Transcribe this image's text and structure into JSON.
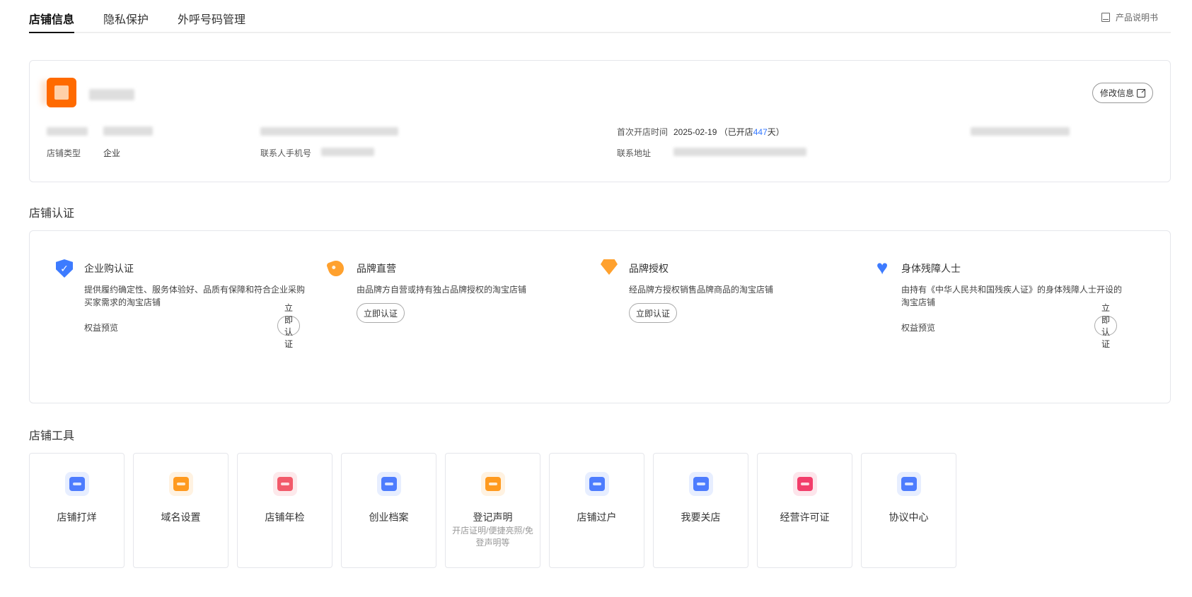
{
  "tabs": [
    {
      "label": "店铺信息",
      "active": true
    },
    {
      "label": "隐私保护",
      "active": false
    },
    {
      "label": "外呼号码管理",
      "active": false
    }
  ],
  "manual": {
    "label": "产品说明书",
    "icon": "book-icon"
  },
  "shop_info": {
    "edit_button": "修改信息",
    "shop_type_label": "店铺类型",
    "shop_type_value": "企业",
    "contact_phone_label": "联系人手机号",
    "first_open_label": "首次开店时间",
    "first_open_date": "2025-02-19",
    "open_prefix": "（已开店",
    "open_days": "447",
    "open_suffix": "天）",
    "address_label": "联系地址"
  },
  "certification": {
    "title": "店铺认证",
    "items": [
      {
        "title": "企业购认证",
        "icon": "shield-check-icon",
        "desc": "提供履约确定性、服务体验好、品质有保障和符合企业采购买家需求的淘宝店铺",
        "benefit": "权益预览",
        "button": "立即认证"
      },
      {
        "title": "品牌直营",
        "icon": "tag-icon",
        "desc": "由品牌方自营或持有独占品牌授权的淘宝店铺",
        "benefit": "",
        "button": "立即认证"
      },
      {
        "title": "品牌授权",
        "icon": "diamond-icon",
        "desc": "经品牌方授权销售品牌商品的淘宝店铺",
        "benefit": "",
        "button": "立即认证"
      },
      {
        "title": "身体残障人士",
        "icon": "accessibility-heart-icon",
        "desc": "由持有《中华人民共和国残疾人证》的身体残障人士开设的淘宝店铺",
        "benefit": "权益预览",
        "button": "立即认证"
      }
    ]
  },
  "tools": {
    "title": "店铺工具",
    "items": [
      {
        "name": "店铺打烊",
        "sub": "",
        "icon": "shop-close-icon",
        "color": "#4d7cfe"
      },
      {
        "name": "域名设置",
        "sub": "",
        "icon": "domain-icon",
        "color": "#ff9a1f"
      },
      {
        "name": "店铺年检",
        "sub": "",
        "icon": "inspection-icon",
        "color": "#f25a6a"
      },
      {
        "name": "创业档案",
        "sub": "",
        "icon": "archive-icon",
        "color": "#4d7cfe"
      },
      {
        "name": "登记声明",
        "sub": "开店证明/便捷亮照/免登声明等",
        "icon": "register-icon",
        "color": "#ff9a1f"
      },
      {
        "name": "店铺过户",
        "sub": "",
        "icon": "transfer-icon",
        "color": "#4d7cfe"
      },
      {
        "name": "我要关店",
        "sub": "",
        "icon": "close-shop-icon",
        "color": "#4d7cfe"
      },
      {
        "name": "经营许可证",
        "sub": "",
        "icon": "license-icon",
        "color": "#f23d6a"
      },
      {
        "name": "协议中心",
        "sub": "",
        "icon": "agreement-icon",
        "color": "#4d7cfe"
      }
    ]
  }
}
